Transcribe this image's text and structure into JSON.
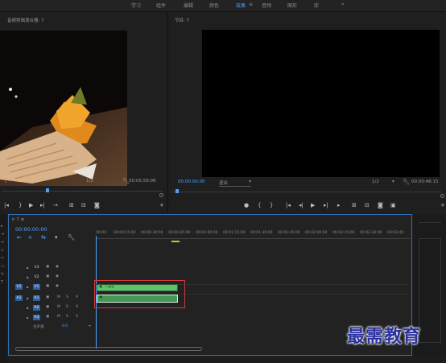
{
  "workspace_tabs": [
    "学习",
    "组件",
    "编辑",
    "颜色",
    "效果",
    "音频",
    "图形",
    "库"
  ],
  "workspace_active": "效果",
  "more_tabs": "»",
  "source_monitor": {
    "title": "音频剪辑混合器: 7",
    "zoom": "1/2",
    "timecode": "00:05:59:06"
  },
  "program_monitor": {
    "title": "节目: 7",
    "menu": "≡",
    "timecode_current": "00:00:00:00",
    "fit": "适合",
    "zoom": "1/2",
    "timecode_end": "00:00:46:15"
  },
  "timeline": {
    "title": "× 7 ≡",
    "timecode": "00:00:00:00",
    "ruler": [
      "00:00",
      "00:00:15:00",
      "00:00:30:00",
      "00:00:45:00",
      "00:01:00:00",
      "00:01:15:00",
      "00:01:30:00",
      "00:01:45:00",
      "00:02:00:00",
      "00:02:15:00",
      "00:02:30:00",
      "00:02:45:"
    ],
    "video_tracks": [
      "V3",
      "V2",
      "V1"
    ],
    "audio_tracks": [
      "A1",
      "A2",
      "A3"
    ],
    "mute": "M",
    "solo": "S",
    "master_label": "主声道",
    "master_value": "0.0",
    "clip_video_label": "7.jpg"
  },
  "watermark": "最需教育",
  "colors": {
    "accent": "#4aa3ff",
    "clip_video": "#5fc26a",
    "clip_audio": "#3f9a52",
    "selection": "#d13a3a",
    "watermark": "#2a2f9e"
  }
}
